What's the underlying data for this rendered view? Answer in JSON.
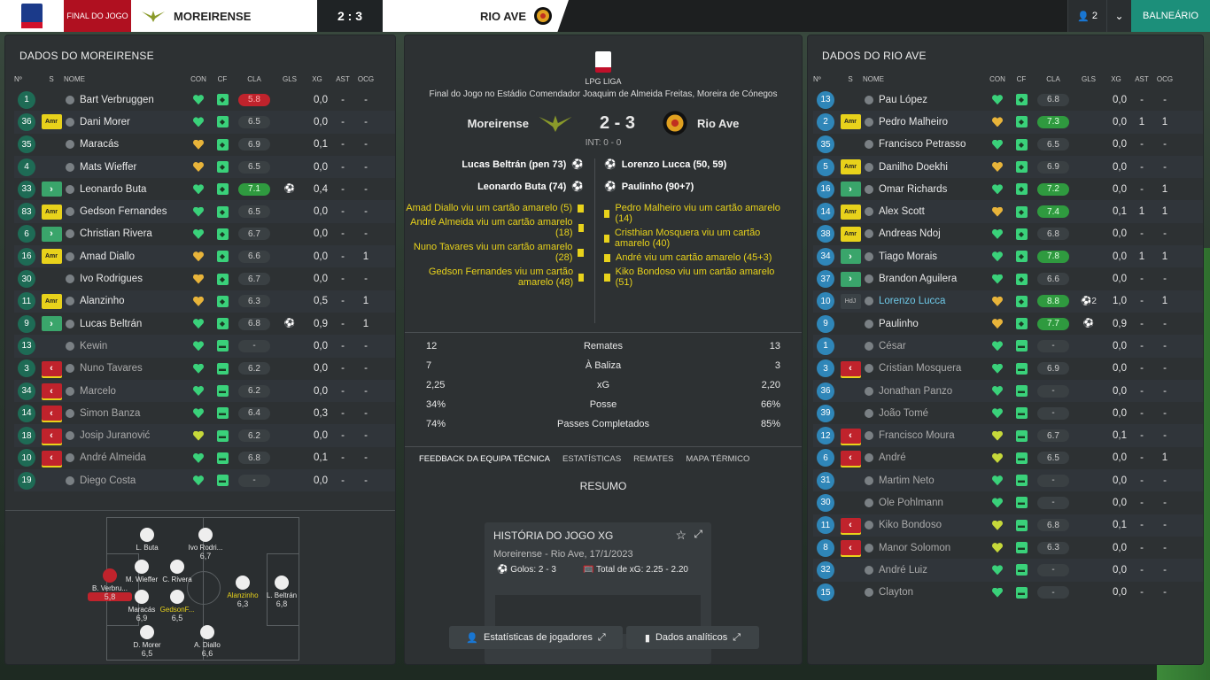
{
  "topbar": {
    "final_label": "FINAL DO JOGO",
    "home": "MOREIRENSE",
    "score": "2 : 3",
    "away": "RIO AVE",
    "users": "2",
    "balneario": "BALNEÁRIO"
  },
  "headers": {
    "no": "Nº",
    "s": "S",
    "nome": "NOME",
    "con": "CON",
    "cf": "CF",
    "cla": "CLA",
    "gls": "GLS",
    "xg": "XG",
    "ast": "AST",
    "ocg": "OCG"
  },
  "home_panel": {
    "title": "DADOS DO MOREIRENSE",
    "players": [
      {
        "no": "1",
        "s": "",
        "name": "Bart Verbruggen",
        "heart": "g",
        "cla": "5.8",
        "cla_color": "r",
        "gls": "",
        "xg": "0,0",
        "ast": "-",
        "ocg": "-",
        "dim": false
      },
      {
        "no": "36",
        "s": "Amr",
        "name": "Dani Morer",
        "heart": "g",
        "cla": "6.5",
        "cla_color": "n",
        "gls": "",
        "xg": "0,0",
        "ast": "-",
        "ocg": "-",
        "dim": false
      },
      {
        "no": "35",
        "s": "",
        "name": "Maracás",
        "heart": "o",
        "cla": "6.9",
        "cla_color": "n",
        "gls": "",
        "xg": "0,1",
        "ast": "-",
        "ocg": "-",
        "dim": false
      },
      {
        "no": "4",
        "s": "",
        "name": "Mats Wieffer",
        "heart": "o",
        "cla": "6.5",
        "cla_color": "n",
        "gls": "",
        "xg": "0,0",
        "ast": "-",
        "ocg": "-",
        "dim": false
      },
      {
        "no": "33",
        "s": "in",
        "name": "Leonardo Buta",
        "heart": "g",
        "cla": "7.1",
        "cla_color": "g",
        "gls": "⚽",
        "xg": "0,4",
        "ast": "-",
        "ocg": "-",
        "dim": false
      },
      {
        "no": "83",
        "s": "Amr",
        "name": "Gedson Fernandes",
        "heart": "g",
        "cla": "6.5",
        "cla_color": "n",
        "gls": "",
        "xg": "0,0",
        "ast": "-",
        "ocg": "-",
        "dim": false
      },
      {
        "no": "6",
        "s": "in",
        "name": "Christian Rivera",
        "heart": "g",
        "cla": "6.7",
        "cla_color": "n",
        "gls": "",
        "xg": "0,0",
        "ast": "-",
        "ocg": "-",
        "dim": false
      },
      {
        "no": "16",
        "s": "Amr",
        "name": "Amad Diallo",
        "heart": "o",
        "cla": "6.6",
        "cla_color": "n",
        "gls": "",
        "xg": "0,0",
        "ast": "-",
        "ocg": "1",
        "dim": false
      },
      {
        "no": "30",
        "s": "",
        "name": "Ivo Rodrigues",
        "heart": "o",
        "cla": "6.7",
        "cla_color": "n",
        "gls": "",
        "xg": "0,0",
        "ast": "-",
        "ocg": "-",
        "dim": false
      },
      {
        "no": "11",
        "s": "Amr",
        "name": "Alanzinho",
        "heart": "o",
        "cla": "6.3",
        "cla_color": "n",
        "gls": "",
        "xg": "0,5",
        "ast": "-",
        "ocg": "1",
        "dim": false
      },
      {
        "no": "9",
        "s": "in",
        "name": "Lucas Beltrán",
        "heart": "g",
        "cla": "6.8",
        "cla_color": "n",
        "gls": "⚽",
        "xg": "0,9",
        "ast": "-",
        "ocg": "1",
        "dim": false
      },
      {
        "no": "13",
        "s": "",
        "name": "Kewin",
        "heart": "g",
        "cla": "-",
        "cla_color": "n",
        "gls": "",
        "xg": "0,0",
        "ast": "-",
        "ocg": "-",
        "dim": true
      },
      {
        "no": "3",
        "s": "out",
        "name": "Nuno Tavares",
        "heart": "g",
        "cla": "6.2",
        "cla_color": "n",
        "gls": "",
        "xg": "0,0",
        "ast": "-",
        "ocg": "-",
        "dim": true
      },
      {
        "no": "34",
        "s": "out",
        "name": "Marcelo",
        "heart": "g",
        "cla": "6.2",
        "cla_color": "n",
        "gls": "",
        "xg": "0,0",
        "ast": "-",
        "ocg": "-",
        "dim": true
      },
      {
        "no": "14",
        "s": "out",
        "name": "Simon Banza",
        "heart": "g",
        "cla": "6.4",
        "cla_color": "n",
        "gls": "",
        "xg": "0,3",
        "ast": "-",
        "ocg": "-",
        "dim": true
      },
      {
        "no": "18",
        "s": "out",
        "name": "Josip Juranović",
        "heart": "y",
        "cla": "6.2",
        "cla_color": "n",
        "gls": "",
        "xg": "0,0",
        "ast": "-",
        "ocg": "-",
        "dim": true
      },
      {
        "no": "10",
        "s": "out",
        "name": "André Almeida",
        "heart": "g",
        "cla": "6.8",
        "cla_color": "n",
        "gls": "",
        "xg": "0,1",
        "ast": "-",
        "ocg": "-",
        "dim": true
      },
      {
        "no": "19",
        "s": "",
        "name": "Diego Costa",
        "heart": "g",
        "cla": "-",
        "cla_color": "n",
        "gls": "",
        "xg": "0,0",
        "ast": "-",
        "ocg": "-",
        "dim": true
      }
    ]
  },
  "away_panel": {
    "title": "DADOS DO RIO AVE",
    "players": [
      {
        "no": "13",
        "s": "",
        "name": "Pau López",
        "heart": "g",
        "cla": "6.8",
        "cla_color": "n",
        "gls": "",
        "xg": "0,0",
        "ast": "-",
        "ocg": "-",
        "dim": false
      },
      {
        "no": "2",
        "s": "Amr",
        "name": "Pedro Malheiro",
        "heart": "o",
        "cla": "7.3",
        "cla_color": "g",
        "gls": "",
        "xg": "0,0",
        "ast": "1",
        "ocg": "1",
        "dim": false
      },
      {
        "no": "35",
        "s": "",
        "name": "Francisco Petrasso",
        "heart": "g",
        "cla": "6.5",
        "cla_color": "n",
        "gls": "",
        "xg": "0,0",
        "ast": "-",
        "ocg": "-",
        "dim": false
      },
      {
        "no": "5",
        "s": "Amr",
        "name": "Danilho Doekhi",
        "heart": "o",
        "cla": "6.9",
        "cla_color": "n",
        "gls": "",
        "xg": "0,0",
        "ast": "-",
        "ocg": "-",
        "dim": false
      },
      {
        "no": "16",
        "s": "in",
        "name": "Omar Richards",
        "heart": "g",
        "cla": "7.2",
        "cla_color": "g",
        "gls": "",
        "xg": "0,0",
        "ast": "-",
        "ocg": "1",
        "dim": false
      },
      {
        "no": "14",
        "s": "Amr",
        "name": "Alex Scott",
        "heart": "o",
        "cla": "7.4",
        "cla_color": "g",
        "gls": "",
        "xg": "0,1",
        "ast": "1",
        "ocg": "1",
        "dim": false
      },
      {
        "no": "38",
        "s": "Amr",
        "name": "Andreas Ndoj",
        "heart": "g",
        "cla": "6.8",
        "cla_color": "n",
        "gls": "",
        "xg": "0,0",
        "ast": "-",
        "ocg": "-",
        "dim": false
      },
      {
        "no": "34",
        "s": "in",
        "name": "Tiago Morais",
        "heart": "g",
        "cla": "7.8",
        "cla_color": "g",
        "gls": "",
        "xg": "0,0",
        "ast": "1",
        "ocg": "1",
        "dim": false
      },
      {
        "no": "37",
        "s": "in",
        "name": "Brandon Aguilera",
        "heart": "g",
        "cla": "6.6",
        "cla_color": "n",
        "gls": "",
        "xg": "0,0",
        "ast": "-",
        "ocg": "-",
        "dim": false
      },
      {
        "no": "10",
        "s": "HdJ",
        "name": "Lorenzo Lucca",
        "heart": "o",
        "cla": "8.8",
        "cla_color": "g",
        "gls": "⚽2",
        "xg": "1,0",
        "ast": "-",
        "ocg": "1",
        "dim": false,
        "hl": true
      },
      {
        "no": "9",
        "s": "",
        "name": "Paulinho",
        "heart": "o",
        "cla": "7.7",
        "cla_color": "g",
        "gls": "⚽",
        "xg": "0,9",
        "ast": "-",
        "ocg": "-",
        "dim": false
      },
      {
        "no": "1",
        "s": "",
        "name": "César",
        "heart": "g",
        "cla": "-",
        "cla_color": "n",
        "gls": "",
        "xg": "0,0",
        "ast": "-",
        "ocg": "-",
        "dim": true
      },
      {
        "no": "3",
        "s": "out",
        "name": "Cristian Mosquera",
        "heart": "g",
        "cla": "6.9",
        "cla_color": "n",
        "gls": "",
        "xg": "0,0",
        "ast": "-",
        "ocg": "-",
        "dim": true
      },
      {
        "no": "36",
        "s": "",
        "name": "Jonathan Panzo",
        "heart": "g",
        "cla": "-",
        "cla_color": "n",
        "gls": "",
        "xg": "0,0",
        "ast": "-",
        "ocg": "-",
        "dim": true
      },
      {
        "no": "39",
        "s": "",
        "name": "João Tomé",
        "heart": "g",
        "cla": "-",
        "cla_color": "n",
        "gls": "",
        "xg": "0,0",
        "ast": "-",
        "ocg": "-",
        "dim": true
      },
      {
        "no": "12",
        "s": "out",
        "name": "Francisco Moura",
        "heart": "y",
        "cla": "6.7",
        "cla_color": "n",
        "gls": "",
        "xg": "0,1",
        "ast": "-",
        "ocg": "-",
        "dim": true
      },
      {
        "no": "6",
        "s": "out",
        "name": "André",
        "heart": "y",
        "cla": "6.5",
        "cla_color": "n",
        "gls": "",
        "xg": "0,0",
        "ast": "-",
        "ocg": "1",
        "dim": true
      },
      {
        "no": "31",
        "s": "",
        "name": "Martim Neto",
        "heart": "g",
        "cla": "-",
        "cla_color": "n",
        "gls": "",
        "xg": "0,0",
        "ast": "-",
        "ocg": "-",
        "dim": true
      },
      {
        "no": "30",
        "s": "",
        "name": "Ole Pohlmann",
        "heart": "g",
        "cla": "-",
        "cla_color": "n",
        "gls": "",
        "xg": "0,0",
        "ast": "-",
        "ocg": "-",
        "dim": true
      },
      {
        "no": "11",
        "s": "out",
        "name": "Kiko Bondoso",
        "heart": "y",
        "cla": "6.8",
        "cla_color": "n",
        "gls": "",
        "xg": "0,1",
        "ast": "-",
        "ocg": "-",
        "dim": true
      },
      {
        "no": "8",
        "s": "out",
        "name": "Manor Solomon",
        "heart": "y",
        "cla": "6.3",
        "cla_color": "n",
        "gls": "",
        "xg": "0,0",
        "ast": "-",
        "ocg": "-",
        "dim": true
      },
      {
        "no": "32",
        "s": "",
        "name": "André Luiz",
        "heart": "g",
        "cla": "-",
        "cla_color": "n",
        "gls": "",
        "xg": "0,0",
        "ast": "-",
        "ocg": "-",
        "dim": true
      },
      {
        "no": "15",
        "s": "",
        "name": "Clayton",
        "heart": "g",
        "cla": "-",
        "cla_color": "n",
        "gls": "",
        "xg": "0,0",
        "ast": "-",
        "ocg": "-",
        "dim": true
      }
    ]
  },
  "match": {
    "league": "LPG LIGA",
    "venue": "Final do Jogo no Estádio Comendador Joaquim de Almeida Freitas, Moreira de Cónegos",
    "home": "Moreirense",
    "away": "Rio Ave",
    "score": "2 - 3",
    "ht": "INT: 0 - 0",
    "home_events": [
      "Lucas Beltrán (pen 73)",
      "Leonardo Buta (74)",
      "Amad Diallo viu um cartão amarelo (5)",
      "André Almeida viu um cartão amarelo (18)",
      "Nuno Tavares viu um cartão amarelo (28)",
      "Gedson Fernandes viu um cartão amarelo (48)"
    ],
    "away_events": [
      "Lorenzo Lucca (50, 59)",
      "Paulinho (90+7)",
      "Pedro Malheiro viu um cartão amarelo (14)",
      "Cristhian Mosquera viu um cartão amarelo (40)",
      "André viu um cartão amarelo (45+3)",
      "Kiko Bondoso viu um cartão amarelo (51)"
    ],
    "stats": [
      {
        "h": "12",
        "l": "Remates",
        "a": "13"
      },
      {
        "h": "7",
        "l": "À Baliza",
        "a": "3"
      },
      {
        "h": "2,25",
        "l": "xG",
        "a": "2,20"
      },
      {
        "h": "34%",
        "l": "Posse",
        "a": "66%"
      },
      {
        "h": "74%",
        "l": "Passes Completados",
        "a": "85%"
      }
    ],
    "tabs": [
      "FEEDBACK DA EQUIPA TÉCNICA",
      "ESTATÍSTICAS",
      "REMATES",
      "MAPA TÉRMICO"
    ],
    "resumo": "RESUMO",
    "card_title": "HISTÓRIA DO JOGO XG",
    "card_sub": "Moreirense - Rio Ave, 17/1/2023",
    "card_goals": "Golos: 2 - 3",
    "card_xg": "Total de xG: 2.25 - 2.20",
    "btn1": "Estatísticas de jogadores",
    "btn2": "Dados analíticos"
  },
  "formation": [
    {
      "name": "B. Verbru...",
      "rating": "5,8",
      "red": true
    },
    {
      "name": "L. Buta",
      "rating": ""
    },
    {
      "name": "Ivo Rodri...",
      "rating": "6,7"
    },
    {
      "name": "M. Wieffer",
      "rating": ""
    },
    {
      "name": "C. Rivera",
      "rating": ""
    },
    {
      "name": "Maracás",
      "rating": "6,9"
    },
    {
      "name": "GedsonF...",
      "rating": "6,5"
    },
    {
      "name": "Alanzinho",
      "rating": "6,3"
    },
    {
      "name": "L. Beltrán",
      "rating": "6,8"
    },
    {
      "name": "D. Morer",
      "rating": "6,5"
    },
    {
      "name": "A. Diallo",
      "rating": "6,6"
    }
  ]
}
